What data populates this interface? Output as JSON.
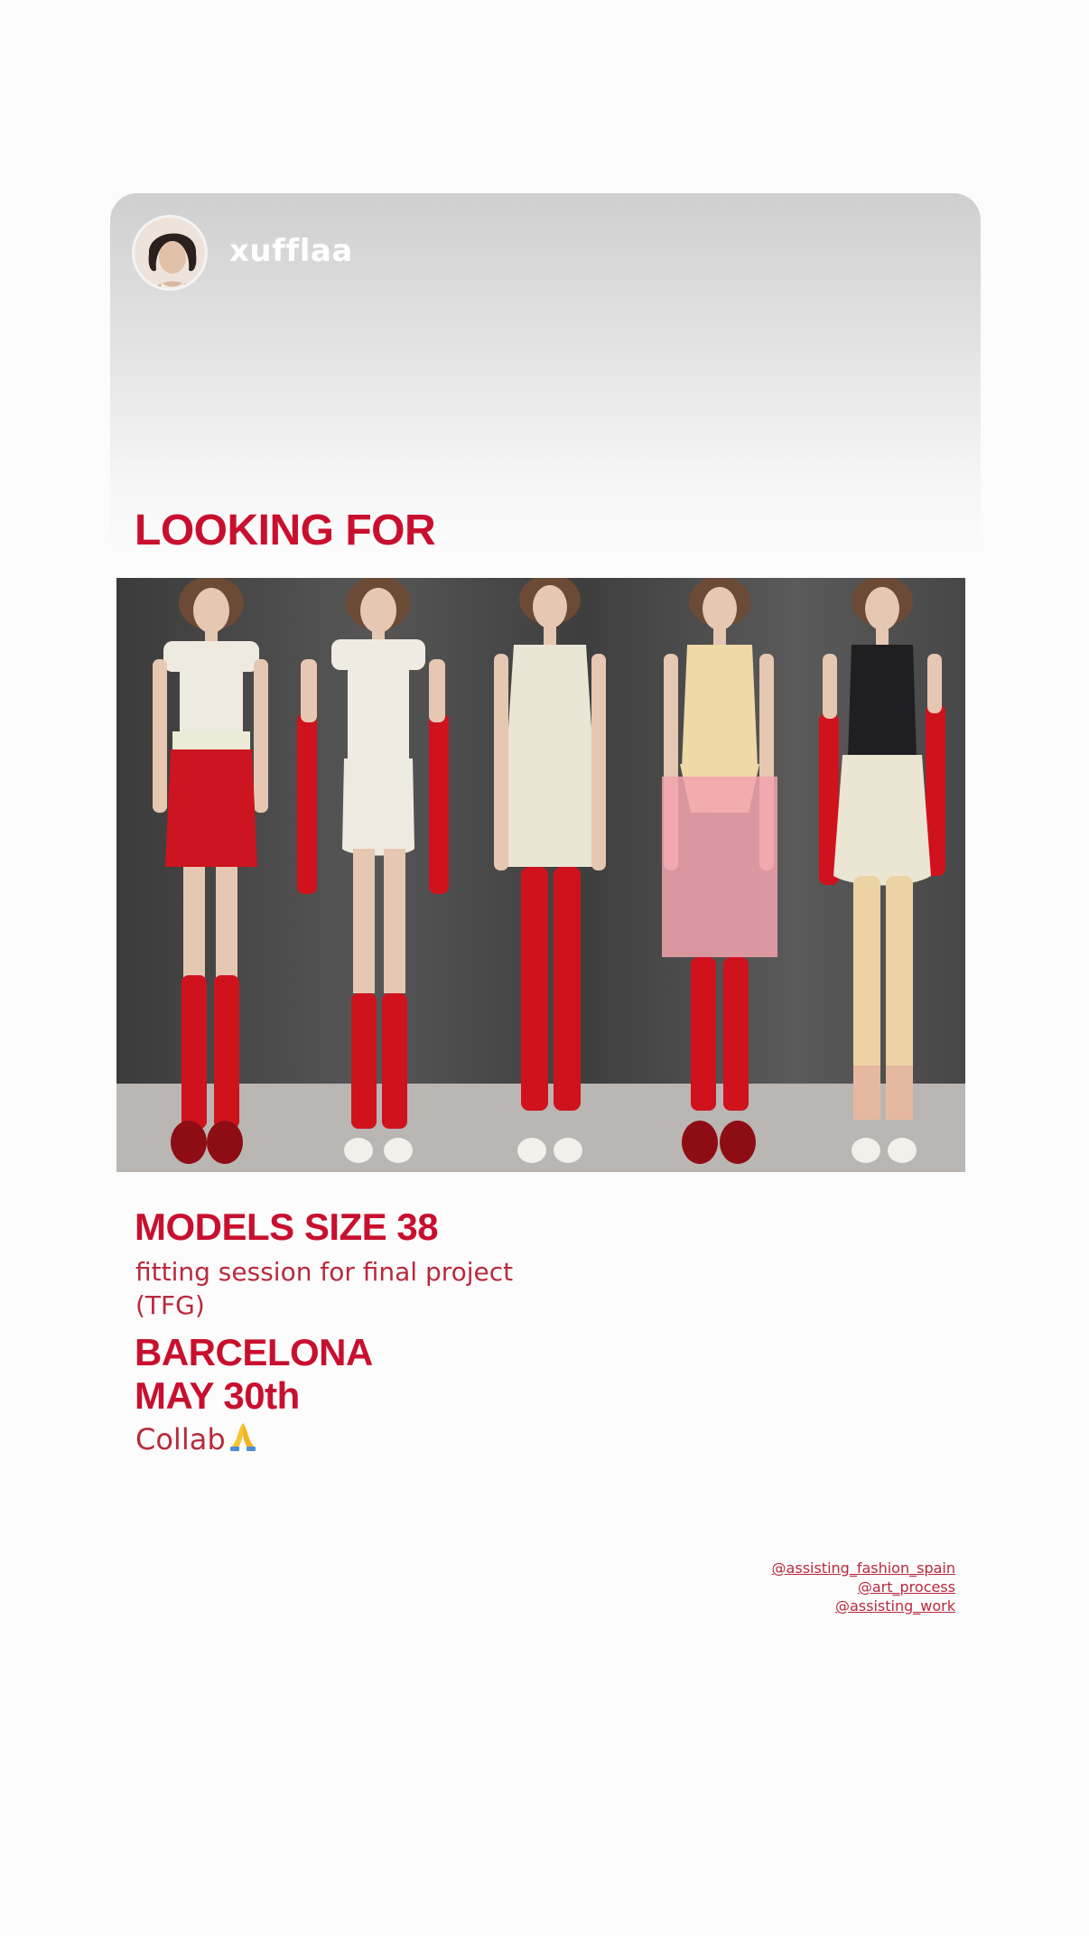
{
  "story": {
    "username": "xufflaa",
    "heading": "LOOKING FOR",
    "models_size": "MODELS SIZE 38",
    "fitting_text": "fitting session  for final project (TFG)",
    "city": "BARCELONA",
    "date": "MAY 30th",
    "collab": "Collab",
    "collab_icon": "folded-hands-emoji",
    "mentions": [
      "@assisting_fashion_spain",
      "@art_process",
      "@assisting_work"
    ]
  },
  "colors": {
    "accent": "#c8102e",
    "text_accent": "#b82a3e",
    "background": "#fdfcfc"
  }
}
